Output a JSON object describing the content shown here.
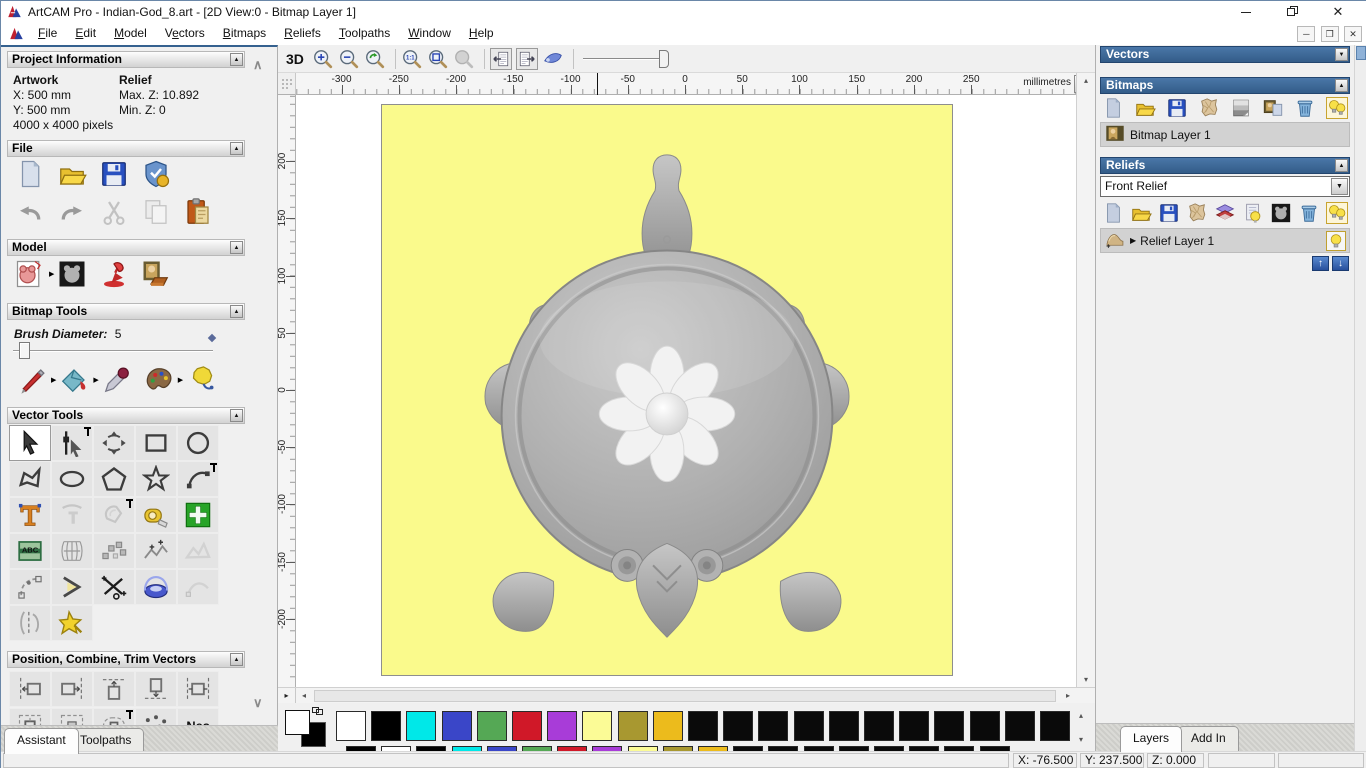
{
  "window": {
    "title": "ArtCAM Pro - Indian-God_8.art - [2D View:0 - Bitmap Layer 1]"
  },
  "menu": {
    "items": [
      {
        "label": "File",
        "accel": 0
      },
      {
        "label": "Edit",
        "accel": 0
      },
      {
        "label": "Model",
        "accel": 0
      },
      {
        "label": "Vectors",
        "accel": 1
      },
      {
        "label": "Bitmaps",
        "accel": 0
      },
      {
        "label": "Reliefs",
        "accel": 0
      },
      {
        "label": "Toolpaths",
        "accel": 0
      },
      {
        "label": "Window",
        "accel": 0
      },
      {
        "label": "Help",
        "accel": 0
      }
    ]
  },
  "assistant": {
    "project_info": {
      "title": "Project Information",
      "artwork_label": "Artwork",
      "artwork_x": "X: 500 mm",
      "artwork_y": "Y: 500 mm",
      "artwork_pixels": "4000 x 4000 pixels",
      "relief_label": "Relief",
      "relief_max": "Max. Z: 10.892",
      "relief_min": "Min. Z: 0"
    },
    "file_section": {
      "title": "File",
      "icons_row1": [
        "new-file",
        "open-file",
        "save-file",
        "model-wizard"
      ],
      "icons_row2": [
        "undo",
        "redo",
        "cut",
        "copy",
        "paste-special"
      ]
    },
    "model_section": {
      "title": "Model",
      "icons": [
        "set-model-size",
        "flyout",
        "greyscale-model",
        "lighting",
        "texture-relief"
      ]
    },
    "bitmap_tools": {
      "title": "Bitmap Tools",
      "brush_label": "Brush Diameter:",
      "brush_value": "5",
      "icons": [
        "paint-brush",
        "flyout",
        "flood-fill",
        "flyout",
        "pick-colour",
        "palette",
        "flyout",
        "reduce-colours"
      ]
    },
    "vector_tools": {
      "title": "Vector Tools",
      "active": "select",
      "grid": [
        [
          "select",
          "node-edit",
          "transform",
          "create-rectangle",
          "create-circle"
        ],
        [
          "create-polyline",
          "create-ellipse",
          "create-polygon",
          "create-star",
          "create-arc"
        ],
        [
          "create-text",
          "wrap-text",
          "offset-vector",
          "measure",
          "paste-vector"
        ],
        [
          "text-block",
          "envelope-distort",
          "paste-along-curve",
          "fillet",
          "join-vectors"
        ],
        [
          "fit-arcs",
          "bevel",
          "trim-vectors",
          "spin-tool",
          "free-curve"
        ],
        [
          "slice",
          "magic-wand"
        ]
      ],
      "pinned": [
        "node-edit",
        "create-arc",
        "offset-vector"
      ]
    },
    "position_section": {
      "title": "Position, Combine, Trim Vectors",
      "row1": [
        "align-left",
        "align-right",
        "align-top",
        "align-bottom",
        "align-centre"
      ],
      "row2": [
        "centre-page",
        "centre-page-2",
        "align-contour",
        "scatter",
        "nest"
      ],
      "pinned": [
        "align-contour"
      ]
    },
    "tabs": [
      {
        "label": "Assistant",
        "active": true
      },
      {
        "label": "Toolpaths",
        "active": false
      }
    ]
  },
  "view_toolbar": {
    "mode_label": "3D",
    "icons": [
      "zoom-in",
      "zoom-out",
      "zoom-last",
      "sep",
      "zoom-1to1",
      "zoom-objects",
      "zoom-limits",
      "sep",
      "page-prev",
      "page-next",
      "transparency",
      "sep"
    ],
    "bordered": [
      "page-prev",
      "page-next"
    ]
  },
  "ruler": {
    "unit": "millimetres",
    "h_values": [
      -300,
      -250,
      -200,
      -150,
      -100,
      -50,
      0,
      50,
      100,
      150,
      200,
      250
    ],
    "v_values": [
      200,
      150,
      100,
      50,
      0,
      -50,
      -100,
      -150,
      -200
    ],
    "marker_x_mm": -76.5
  },
  "canvas": {
    "bg_color": "#fafa8c"
  },
  "layers_panel": {
    "vectors": {
      "title": "Vectors"
    },
    "bitmaps": {
      "title": "Bitmaps",
      "icons": [
        "new-page",
        "open-file",
        "save-file",
        "crumple",
        "gradient-page",
        "merge-bitmap",
        "trash",
        "bulbs"
      ],
      "lit": [
        "bulbs"
      ],
      "layer_name": "Bitmap Layer 1"
    },
    "reliefs": {
      "title": "Reliefs",
      "selected": "Front Relief",
      "icons": [
        "new-page",
        "open-file",
        "save-file",
        "crumple",
        "layer-stack",
        "bulb-page",
        "greyscale-model",
        "trash",
        "bulbs"
      ],
      "lit": [
        "bulbs"
      ],
      "layer_name": "Relief Layer 1"
    },
    "tabs": [
      {
        "label": "Layers",
        "active": true
      },
      {
        "label": "Add In",
        "active": false
      }
    ]
  },
  "palette": {
    "primary": "#ffffff",
    "secondary": "#000000",
    "row1": [
      "#ffffff",
      "#000000",
      "#00e8e8",
      "#3a46c8",
      "#55a855",
      "#d01828",
      "#a83cd8",
      "#fbfb96",
      "#a89830",
      "#ecbb1c",
      "#0a0a0a",
      "#0a0a0a",
      "#0a0a0a",
      "#0a0a0a",
      "#0a0a0a",
      "#0a0a0a",
      "#0a0a0a",
      "#0a0a0a",
      "#0a0a0a",
      "#0a0a0a",
      "#0a0a0a"
    ],
    "row2": [
      "#000000",
      "#ffffff",
      "#000000",
      "#00e8e8",
      "#3a46c8",
      "#55a855",
      "#d01828",
      "#a83cd8",
      "#fbfb96",
      "#a89830",
      "#ecbb1c",
      "#0a0a0a",
      "#0a0a0a",
      "#0a0a0a",
      "#0a0a0a",
      "#0a0a0a",
      "#0a0a0a",
      "#0a0a0a",
      "#0a0a0a"
    ]
  },
  "status_bar": {
    "x": "X: -76.500",
    "y": "Y: 237.500",
    "z": "Z: 0.000"
  }
}
